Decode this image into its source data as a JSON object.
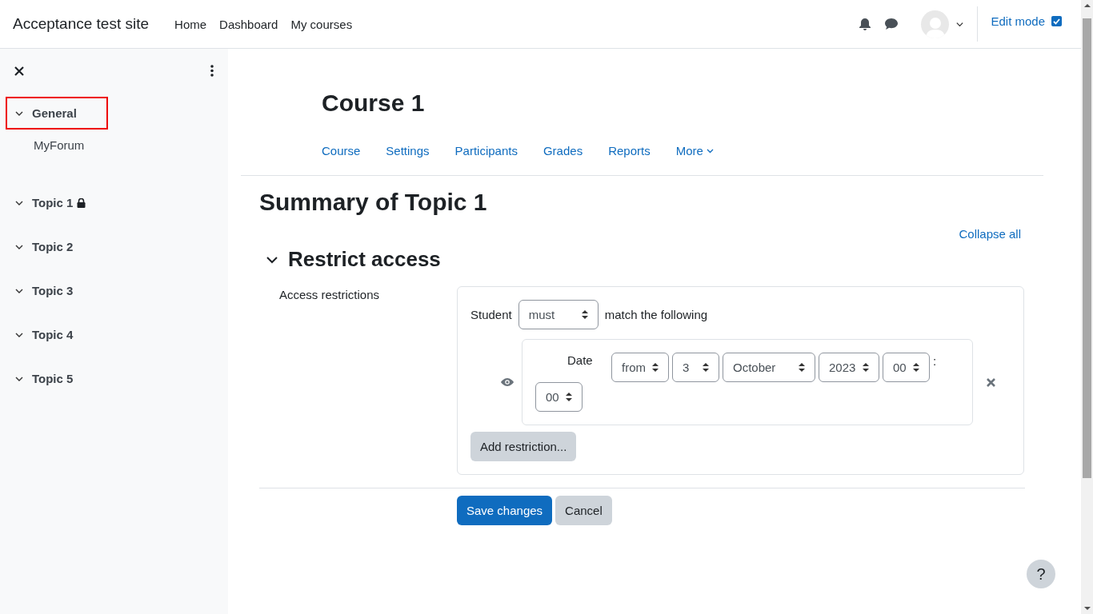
{
  "navbar": {
    "site_name": "Acceptance test site",
    "links": [
      {
        "label": "Home",
        "selected": false
      },
      {
        "label": "Dashboard",
        "selected": false
      },
      {
        "label": "My courses",
        "selected": false
      }
    ],
    "edit_mode": {
      "label": "Edit mode",
      "checked": true
    }
  },
  "sidebar": {
    "sections": [
      {
        "label": "General",
        "expanded": true,
        "focused": true,
        "locked": false,
        "children": [
          {
            "label": "MyForum"
          }
        ]
      },
      {
        "label": "Topic 1",
        "expanded": true,
        "focused": false,
        "locked": true
      },
      {
        "label": "Topic 2",
        "expanded": true,
        "focused": false,
        "locked": false
      },
      {
        "label": "Topic 3",
        "expanded": true,
        "focused": false,
        "locked": false
      },
      {
        "label": "Topic 4",
        "expanded": true,
        "focused": false,
        "locked": false
      },
      {
        "label": "Topic 5",
        "expanded": true,
        "focused": false,
        "locked": false
      }
    ]
  },
  "course": {
    "title": "Course 1",
    "tabs": [
      {
        "label": "Course",
        "selected": false
      },
      {
        "label": "Settings",
        "selected": false
      },
      {
        "label": "Participants",
        "selected": false
      },
      {
        "label": "Grades",
        "selected": false
      },
      {
        "label": "Reports",
        "selected": false
      },
      {
        "label": "More",
        "selected": false
      }
    ]
  },
  "page_title": "Summary of Topic 1",
  "collapse_all": "Collapse all",
  "section": {
    "title": "Restrict access",
    "expanded": true,
    "label": "Access restrictions",
    "student_label": "Student",
    "match_select": "must",
    "match_text": "match the following",
    "condition": {
      "type_label": "Date",
      "items": [
        {
          "kind": "select",
          "value": "from"
        },
        {
          "kind": "select",
          "value": "3"
        },
        {
          "kind": "select",
          "value": "October"
        },
        {
          "kind": "select",
          "value": "2023"
        },
        {
          "kind": "select",
          "value": "00"
        },
        {
          "kind": "separator",
          "value": ":"
        },
        {
          "kind": "select",
          "value": "00"
        }
      ]
    },
    "add_button": "Add restriction..."
  },
  "buttons": [
    {
      "label": "Save changes",
      "kind": "primary"
    },
    {
      "label": "Cancel",
      "kind": "secondary"
    }
  ],
  "help_button": "?"
}
